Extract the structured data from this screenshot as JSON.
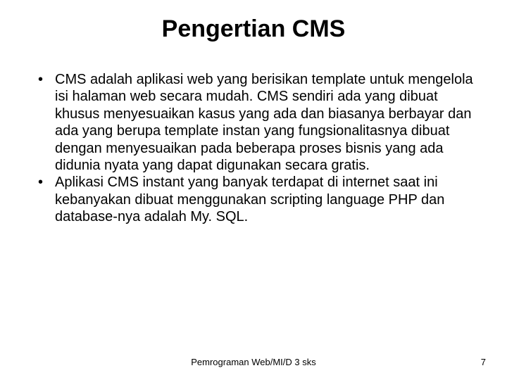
{
  "title": "Pengertian CMS",
  "bullets": [
    "CMS adalah aplikasi web yang berisikan template untuk mengelola isi halaman web secara mudah. CMS sendiri ada yang dibuat khusus menyesuaikan kasus yang ada dan biasanya berbayar dan ada yang berupa template instan yang fungsionalitasnya dibuat dengan menyesuaikan pada beberapa proses bisnis yang ada didunia nyata yang dapat digunakan secara gratis.",
    "Aplikasi CMS instant yang banyak terdapat di internet saat ini kebanyakan dibuat menggunakan scripting language PHP dan database-nya adalah My. SQL."
  ],
  "footer": "Pemrograman Web/MI/D 3 sks",
  "page_number": "7"
}
